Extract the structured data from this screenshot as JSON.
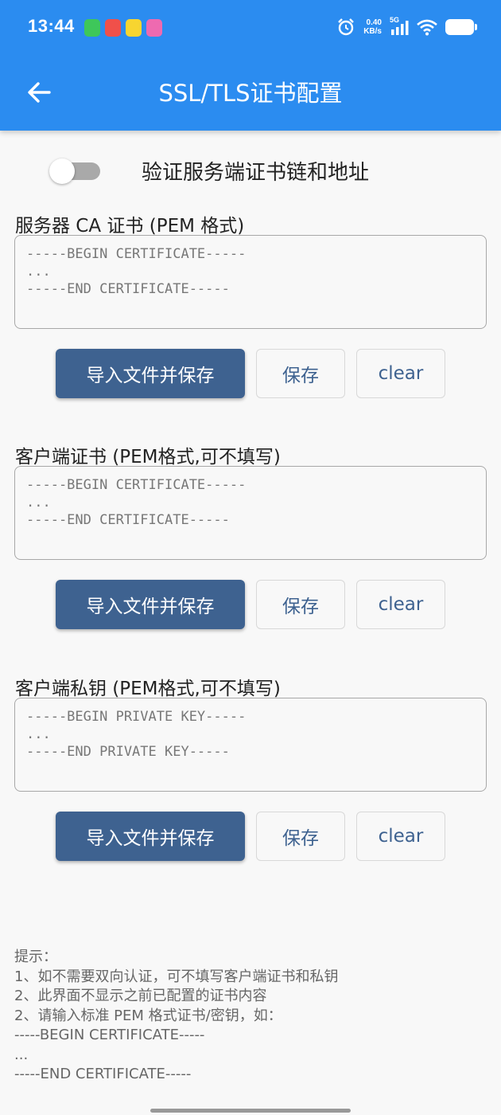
{
  "status_bar": {
    "time": "13:44",
    "speed_value": "0.40",
    "speed_unit": "KB/s",
    "network": "5G"
  },
  "app_bar": {
    "title": "SSL/TLS证书配置"
  },
  "verify_toggle": {
    "label": "验证服务端证书链和地址",
    "enabled": false
  },
  "sections": [
    {
      "label": "服务器 CA 证书 (PEM 格式)",
      "placeholder": "-----BEGIN CERTIFICATE-----\n...\n-----END CERTIFICATE-----",
      "import_label": "导入文件并保存",
      "save_label": "保存",
      "clear_label": "clear"
    },
    {
      "label": "客户端证书 (PEM格式,可不填写)",
      "placeholder": "-----BEGIN CERTIFICATE-----\n...\n-----END CERTIFICATE-----",
      "import_label": "导入文件并保存",
      "save_label": "保存",
      "clear_label": "clear"
    },
    {
      "label": "客户端私钥 (PEM格式,可不填写)",
      "placeholder": "-----BEGIN PRIVATE KEY-----\n...\n-----END PRIVATE KEY-----",
      "import_label": "导入文件并保存",
      "save_label": "保存",
      "clear_label": "clear"
    }
  ],
  "tips": {
    "lines": [
      "提示：",
      "1、如不需要双向认证，可不填写客户端证书和私钥",
      "2、此界面不显示之前已配置的证书内容",
      "2、请输入标准 PEM 格式证书/密钥，如：",
      "-----BEGIN CERTIFICATE-----",
      "...",
      "-----END CERTIFICATE-----"
    ]
  },
  "colors": {
    "app_bar": "#2b8cf0",
    "primary_button": "#3e6290",
    "background": "#f8f8f8"
  }
}
